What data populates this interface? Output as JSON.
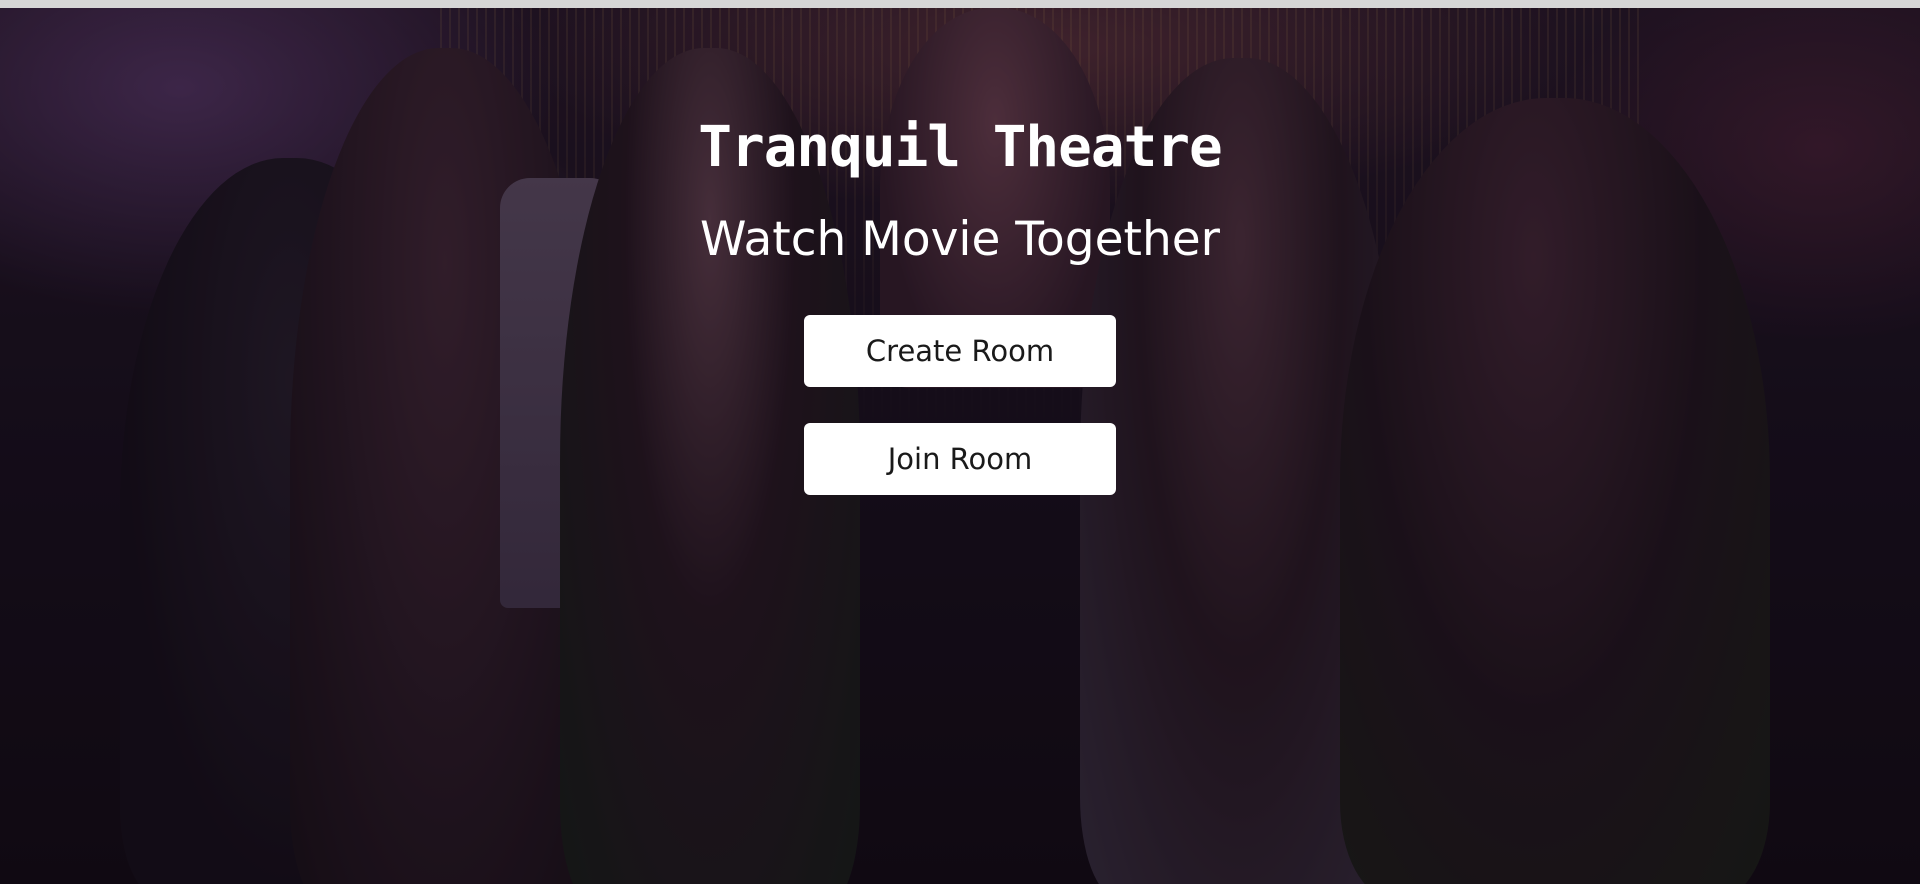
{
  "hero": {
    "title": "Tranquil Theatre",
    "subtitle": "Watch Movie Together",
    "background": "party-photo"
  },
  "actions": {
    "create_room_label": "Create Room",
    "join_room_label": "Join Room"
  },
  "colors": {
    "button_background": "#ffffff",
    "button_text": "#1a1a1a",
    "heading_text": "#ffffff",
    "overlay": "#0e0810"
  }
}
